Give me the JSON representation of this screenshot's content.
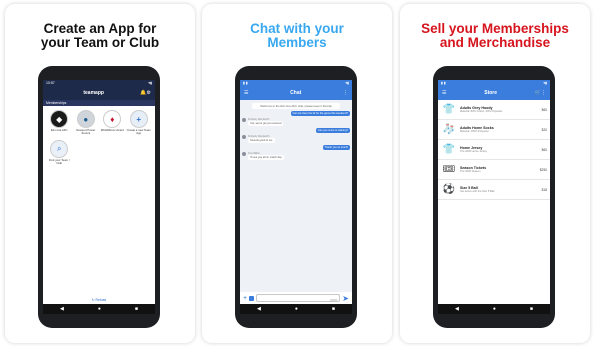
{
  "panels": [
    {
      "headline": [
        "Create an App for",
        "your Team or Club"
      ],
      "headline_color": "#111111"
    },
    {
      "headline": [
        "Chat with your",
        "Members"
      ],
      "headline_color": "#39a8f0"
    },
    {
      "headline": [
        "Sell your Memberships",
        "and Merchandise"
      ],
      "headline_color": "#d6151e"
    }
  ],
  "screen1": {
    "status_time": "10:57",
    "app_name": "teamapp",
    "section_label": "Memberships",
    "clubs": [
      {
        "name": "Elm-Gra AFC",
        "icon": "shield-icon"
      },
      {
        "name": "Newport Power Juniors",
        "icon": "ball-icon"
      },
      {
        "name": "MKHillbrow United",
        "icon": "crest-icon"
      },
      {
        "name": "Create a new Team App",
        "icon": "plus-icon",
        "glyph": "+"
      },
      {
        "name": "Find your Team / Club",
        "icon": "search-icon",
        "glyph": "⌕"
      }
    ],
    "reload_label": "↻ Reload"
  },
  "screen2": {
    "title": "Chat",
    "pinned_note": "Welcome to the Elm-Gra AFC chat, please keep it friendly",
    "messages": [
      {
        "side": "right",
        "text": "Can we have the kit for the game this weekend?"
      },
      {
        "side": "left",
        "sender": "Kimberly Wentworth",
        "text": "Yes, we've got you covered"
      },
      {
        "side": "right",
        "text": "Can you come to training?"
      },
      {
        "side": "left",
        "sender": "Kimberly Wentworth",
        "text": "Sounds good to me"
      },
      {
        "side": "right",
        "text": "Thank you so much!"
      },
      {
        "side": "left",
        "sender": "Trent Miller",
        "text": "I'll see you all on match day"
      }
    ],
    "input_counter": "0/2000"
  },
  "screen3": {
    "title": "Store",
    "products": [
      {
        "name": "Adults Grey Hoody",
        "desc": "Material: 80% Cotton, 20% Polyester",
        "price": "$60",
        "icon": "hoody-icon",
        "glyph": "👕"
      },
      {
        "name": "Adults Home Socks",
        "desc": "Material: 100% Polyester",
        "price": "$20",
        "icon": "socks-icon",
        "glyph": "🧦"
      },
      {
        "name": "Home Jersey",
        "desc": "The 2020 Home Jersey",
        "price": "$60",
        "icon": "jersey-icon",
        "glyph": "👕"
      },
      {
        "name": "Season Tickets",
        "desc": "The 2020 Season",
        "price": "$250",
        "icon": "ticket-icon",
        "glyph": "🎟"
      },
      {
        "name": "Size 5 Ball",
        "desc": "Get active with the Size 5 Ball",
        "price": "$18",
        "icon": "ball-icon",
        "glyph": "⚽"
      }
    ]
  },
  "colors": {
    "dark_nav": "#1e2a4a",
    "blue_bar": "#3b7ddd"
  }
}
